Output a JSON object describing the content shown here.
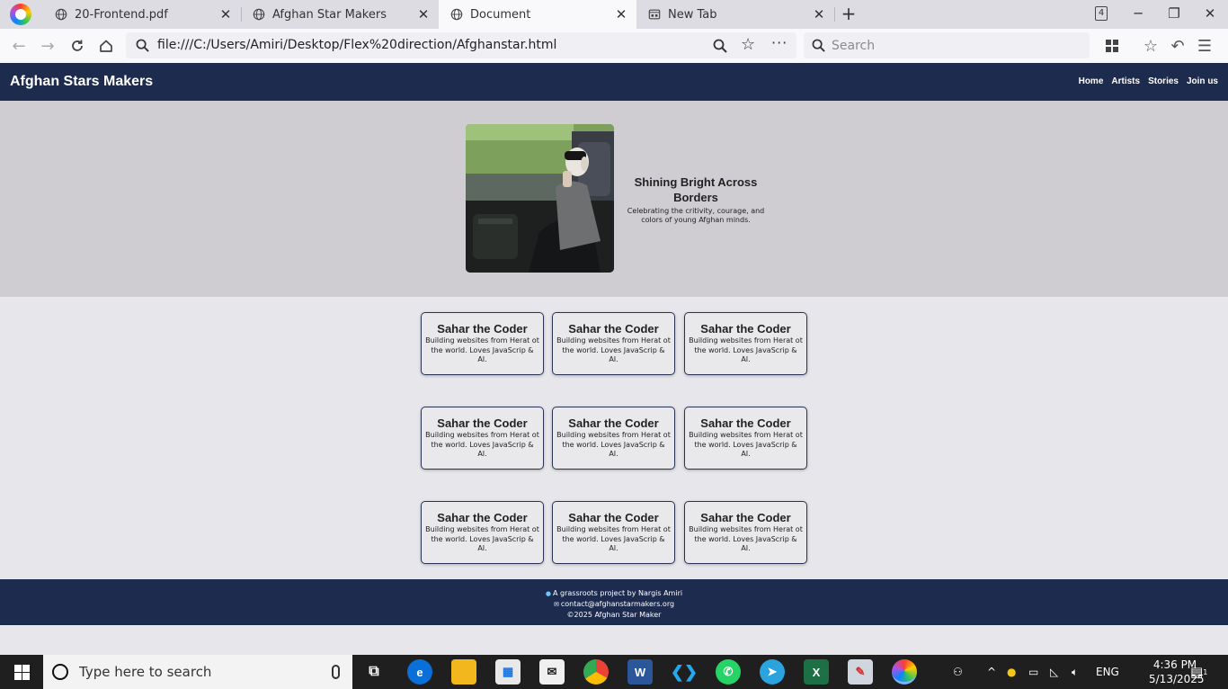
{
  "browser": {
    "tabs": [
      {
        "title": "20-Frontend.pdf",
        "active": false
      },
      {
        "title": "Afghan Star Makers",
        "active": false
      },
      {
        "title": "Document",
        "active": true
      },
      {
        "title": "New Tab",
        "active": false
      }
    ],
    "tab_count": "4",
    "url": "file:///C:/Users/Amiri/Desktop/Flex%20direction/Afghanstar.html",
    "search_placeholder": "Search"
  },
  "site": {
    "brand": "Afghan Stars Makers",
    "nav": [
      "Home",
      "Artists",
      "Stories",
      "Join us"
    ],
    "hero": {
      "title": "Shining Bright Across Borders",
      "subtitle": "Celebrating the critivity, courage, and colors of young Afghan minds."
    },
    "cards": [
      {
        "title": "Sahar the Coder",
        "desc": "Building websites from Herat ot the world. Loves JavaScrip & AI."
      },
      {
        "title": "Sahar the Coder",
        "desc": "Building websites from Herat ot the world. Loves JavaScrip & AI."
      },
      {
        "title": "Sahar the Coder",
        "desc": "Building websites from Herat ot the world. Loves JavaScrip & AI."
      },
      {
        "title": "Sahar the Coder",
        "desc": "Building websites from Herat ot the world. Loves JavaScrip & AI."
      },
      {
        "title": "Sahar the Coder",
        "desc": "Building websites from Herat ot the world. Loves JavaScrip & AI."
      },
      {
        "title": "Sahar the Coder",
        "desc": "Building websites from Herat ot the world. Loves JavaScrip & AI."
      },
      {
        "title": "Sahar the Coder",
        "desc": "Building websites from Herat ot the world. Loves JavaScrip & AI."
      },
      {
        "title": "Sahar the Coder",
        "desc": "Building websites from Herat ot the world. Loves JavaScrip & AI."
      },
      {
        "title": "Sahar the Coder",
        "desc": "Building websites from Herat ot the world. Loves JavaScrip & AI."
      }
    ],
    "footer": {
      "line1": "A grassroots project by Nargis Amiri",
      "line2": "contact@afghanstarmakers.org",
      "line3": "©2025 Afghan Star Maker"
    },
    "colors": {
      "navy": "#1d2b4f",
      "hero_bg": "#cfcdd1",
      "page_bg": "#e6e6eb"
    }
  },
  "taskbar": {
    "search_placeholder": "Type here to search",
    "language": "ENG",
    "time": "4:36 PM",
    "date": "5/13/2025",
    "notification_count": "1"
  }
}
